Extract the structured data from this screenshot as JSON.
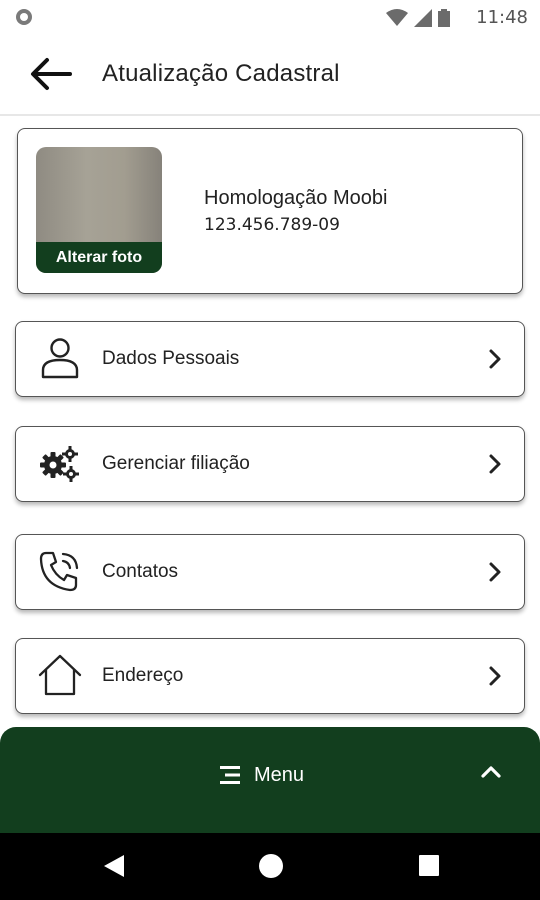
{
  "status_bar": {
    "time": "11:48"
  },
  "app_bar": {
    "title": "Atualização Cadastral"
  },
  "profile": {
    "change_photo_label": "Alterar foto",
    "name": "Homologação Moobi",
    "cpf": "123.456.789-09"
  },
  "menu_items": [
    {
      "label": "Dados Pessoais",
      "icon": "person-icon"
    },
    {
      "label": "Gerenciar filiação",
      "icon": "gears-icon"
    },
    {
      "label": "Contatos",
      "icon": "phone-ringing-icon"
    },
    {
      "label": "Endereço",
      "icon": "house-icon"
    }
  ],
  "bottom_menu": {
    "label": "Menu"
  },
  "colors": {
    "brand_green": "#123e1e",
    "text": "#222222",
    "border": "#555555"
  }
}
